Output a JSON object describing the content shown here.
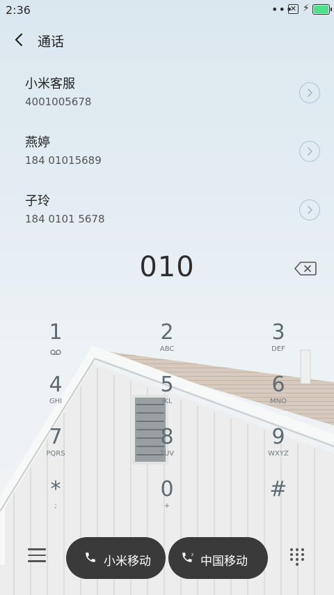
{
  "status": {
    "time": "2:36"
  },
  "header": {
    "title": "通话"
  },
  "contacts": [
    {
      "name": "小米客服",
      "number": "4001005678"
    },
    {
      "name": "燕婷",
      "number": "184 01015689"
    },
    {
      "name": "子玲",
      "number": "184 0101 5678"
    }
  ],
  "dialer": {
    "number": "010",
    "keys": [
      {
        "digit": "1",
        "letters": ""
      },
      {
        "digit": "2",
        "letters": "ABC"
      },
      {
        "digit": "3",
        "letters": "DEF"
      },
      {
        "digit": "4",
        "letters": "GHI"
      },
      {
        "digit": "5",
        "letters": "JKL"
      },
      {
        "digit": "6",
        "letters": "MNO"
      },
      {
        "digit": "7",
        "letters": "PQRS"
      },
      {
        "digit": "8",
        "letters": "TUV"
      },
      {
        "digit": "9",
        "letters": "WXYZ"
      },
      {
        "digit": "*",
        "letters": ";"
      },
      {
        "digit": "0",
        "letters": "+"
      },
      {
        "digit": "#",
        "letters": ""
      }
    ]
  },
  "actions": {
    "sim1_label": "小米移动",
    "sim2_label": "中国移动"
  },
  "icons": [
    "back-icon",
    "voicemail-icon",
    "backspace-icon",
    "menu-icon",
    "phone-icon",
    "keypad-icon"
  ]
}
